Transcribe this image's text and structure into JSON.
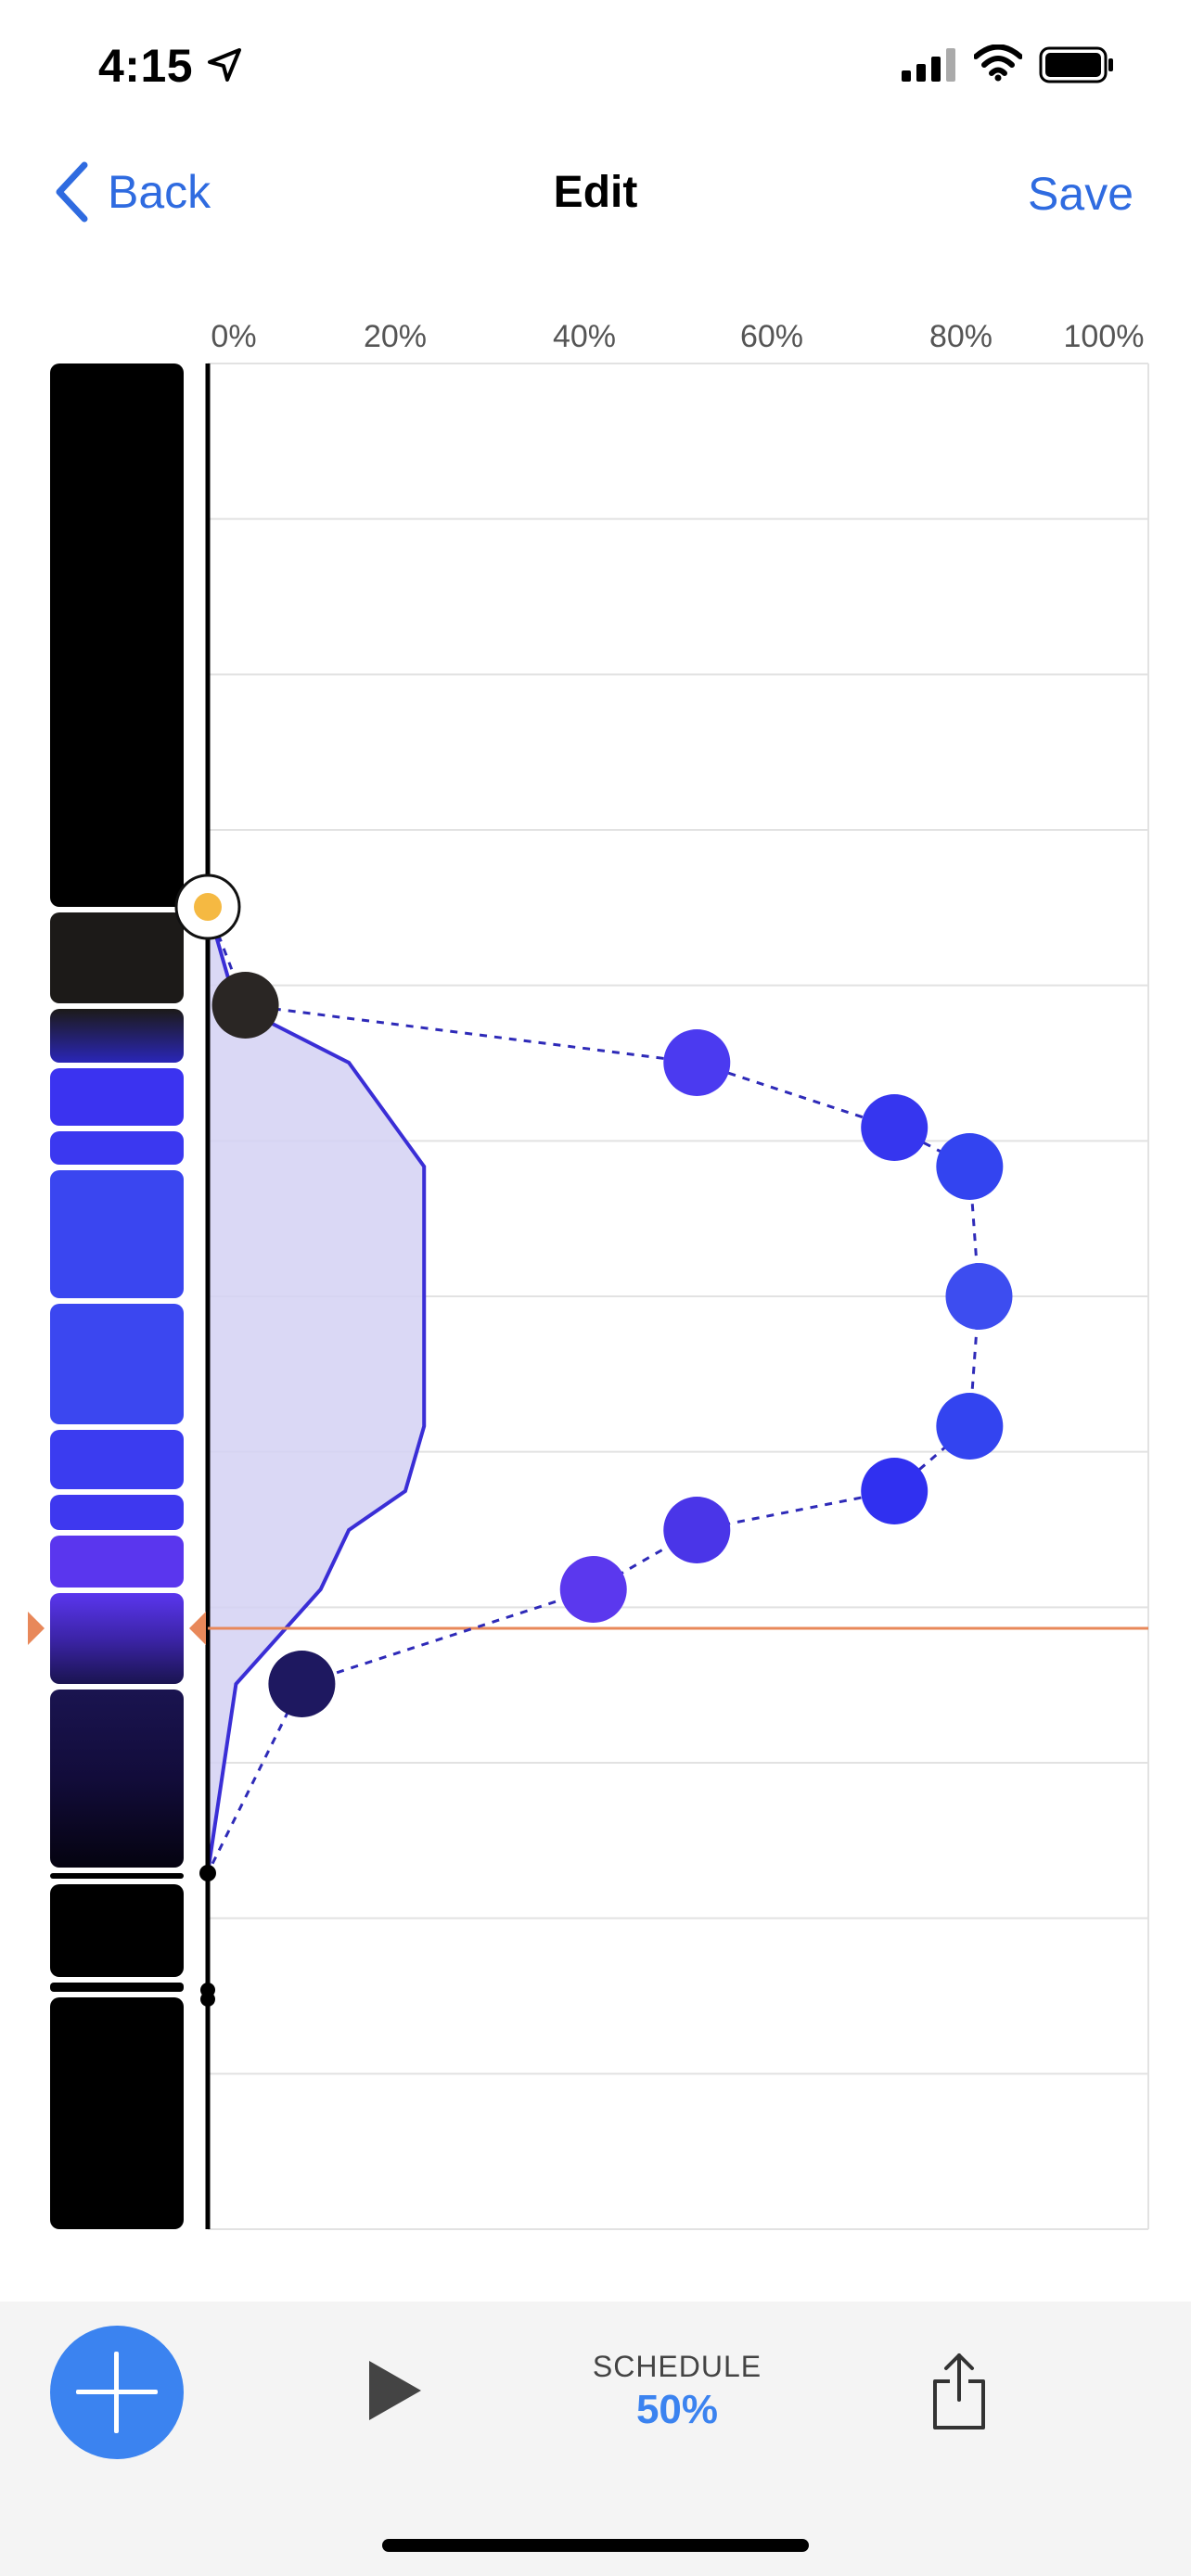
{
  "status_bar": {
    "time": "4:15",
    "icons": [
      "location-arrow-icon",
      "cellular-signal-icon",
      "wifi-icon",
      "battery-icon"
    ]
  },
  "nav": {
    "back_label": "Back",
    "title": "Edit",
    "save_label": "Save",
    "accent_color": "#2f6be0"
  },
  "chart": {
    "x_ticks": [
      "0%",
      "20%",
      "40%",
      "60%",
      "80%",
      "100%"
    ],
    "playhead_color": "#e8885a",
    "curve_color": "#3a2ed6",
    "fill_color": "#d4d1f3"
  },
  "chart_data": {
    "type": "line",
    "orientation": "horizontal-values-vertical-time",
    "x_tick_labels": [
      "0%",
      "20%",
      "40%",
      "60%",
      "80%",
      "100%"
    ],
    "x_range_percent": [
      0,
      100
    ],
    "grid": true,
    "schedule_points": [
      {
        "step": 1,
        "value": 0,
        "color": "#f5b942",
        "role": "sunrise-handle"
      },
      {
        "step": 2,
        "value": 4,
        "color": "#2a2624"
      },
      {
        "step": 3,
        "value": 52,
        "color": "#4b3af0"
      },
      {
        "step": 4,
        "value": 73,
        "color": "#3636ef"
      },
      {
        "step": 5,
        "value": 81,
        "color": "#3344f0"
      },
      {
        "step": 6,
        "value": 82,
        "color": "#3d4df0"
      },
      {
        "step": 7,
        "value": 81,
        "color": "#3344f0"
      },
      {
        "step": 8,
        "value": 73,
        "color": "#3030f0"
      },
      {
        "step": 9,
        "value": 52,
        "color": "#4a35e8"
      },
      {
        "step": 10,
        "value": 41,
        "color": "#5b38ee"
      },
      {
        "step": 11,
        "value": 10,
        "color": "#1e1860"
      },
      {
        "step": 12,
        "value": 0,
        "color": "#000000",
        "role": "end-handle"
      }
    ],
    "intensity_curve": [
      0,
      3,
      15,
      20,
      23,
      23,
      23,
      21,
      15,
      12,
      3,
      0
    ],
    "playhead_step": 10.3
  },
  "color_strip": [
    {
      "color": "#000000"
    },
    {
      "color": "#1c1a18"
    },
    {
      "color": "#2a26b8"
    },
    {
      "color": "#3b33f0"
    },
    {
      "color": "#3b38f0"
    },
    {
      "color": "#3a46f0"
    },
    {
      "color": "#3b47f0"
    },
    {
      "color": "#3b3cf0"
    },
    {
      "color": "#3e38ef"
    },
    {
      "color": "#5a36ee"
    },
    {
      "color": "#3c24a8"
    },
    {
      "color": "#120c3a"
    },
    {
      "color": "#000000"
    },
    {
      "color": "#000000"
    },
    {
      "color": "#000000"
    },
    {
      "color": "#000000"
    }
  ],
  "toolbar": {
    "add_icon": "plus-icon",
    "play_icon": "play-icon",
    "schedule_label": "SCHEDULE",
    "schedule_value": "50%",
    "share_icon": "share-icon",
    "accent_color": "#3b83f0"
  }
}
